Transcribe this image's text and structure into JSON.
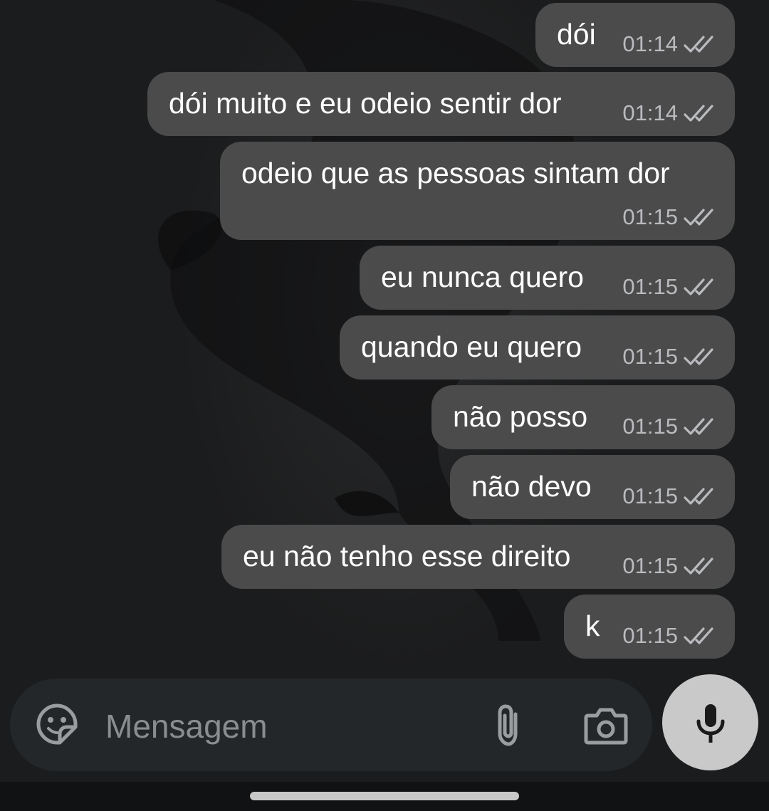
{
  "messages": [
    {
      "text": "dói",
      "time": "01:14",
      "status": "read"
    },
    {
      "text": "dói muito e eu odeio sentir dor",
      "time": "01:14",
      "status": "read"
    },
    {
      "text": "odeio que as pessoas sintam dor",
      "time": "01:15",
      "status": "read"
    },
    {
      "text": "eu nunca quero",
      "time": "01:15",
      "status": "read"
    },
    {
      "text": "quando eu quero",
      "time": "01:15",
      "status": "read"
    },
    {
      "text": "não posso",
      "time": "01:15",
      "status": "read"
    },
    {
      "text": "não devo",
      "time": "01:15",
      "status": "read"
    },
    {
      "text": "eu não tenho esse direito",
      "time": "01:15",
      "status": "read"
    },
    {
      "text": "k",
      "time": "01:15",
      "status": "read"
    }
  ],
  "composer": {
    "placeholder": "Mensagem",
    "emoji_icon": "sticker-emoji-icon",
    "attach_icon": "paperclip-icon",
    "camera_icon": "camera-icon",
    "mic_icon": "microphone-icon"
  },
  "colors": {
    "bubble": "#4b4b4c",
    "composer": "#23272a",
    "mic_button": "#c9c9c9",
    "time_text": "#b9bbbe"
  }
}
